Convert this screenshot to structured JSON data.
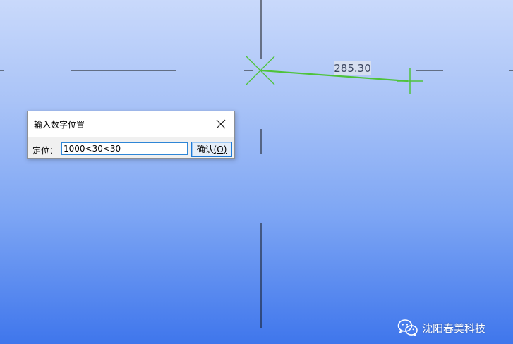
{
  "drawing": {
    "dimension_value": "285.30",
    "line_color": "#4ec33b",
    "background_top": "#c9d9fb",
    "background_bottom": "#3f76ec"
  },
  "dialog": {
    "title": "输入数字位置",
    "close_icon": "close-icon",
    "field_label": "定位：",
    "input_value": "1000<30<30",
    "confirm_label": "确认",
    "confirm_mnemonic": "(O)"
  },
  "watermark": {
    "icon": "wechat-icon",
    "text": "沈阳春美科技"
  }
}
